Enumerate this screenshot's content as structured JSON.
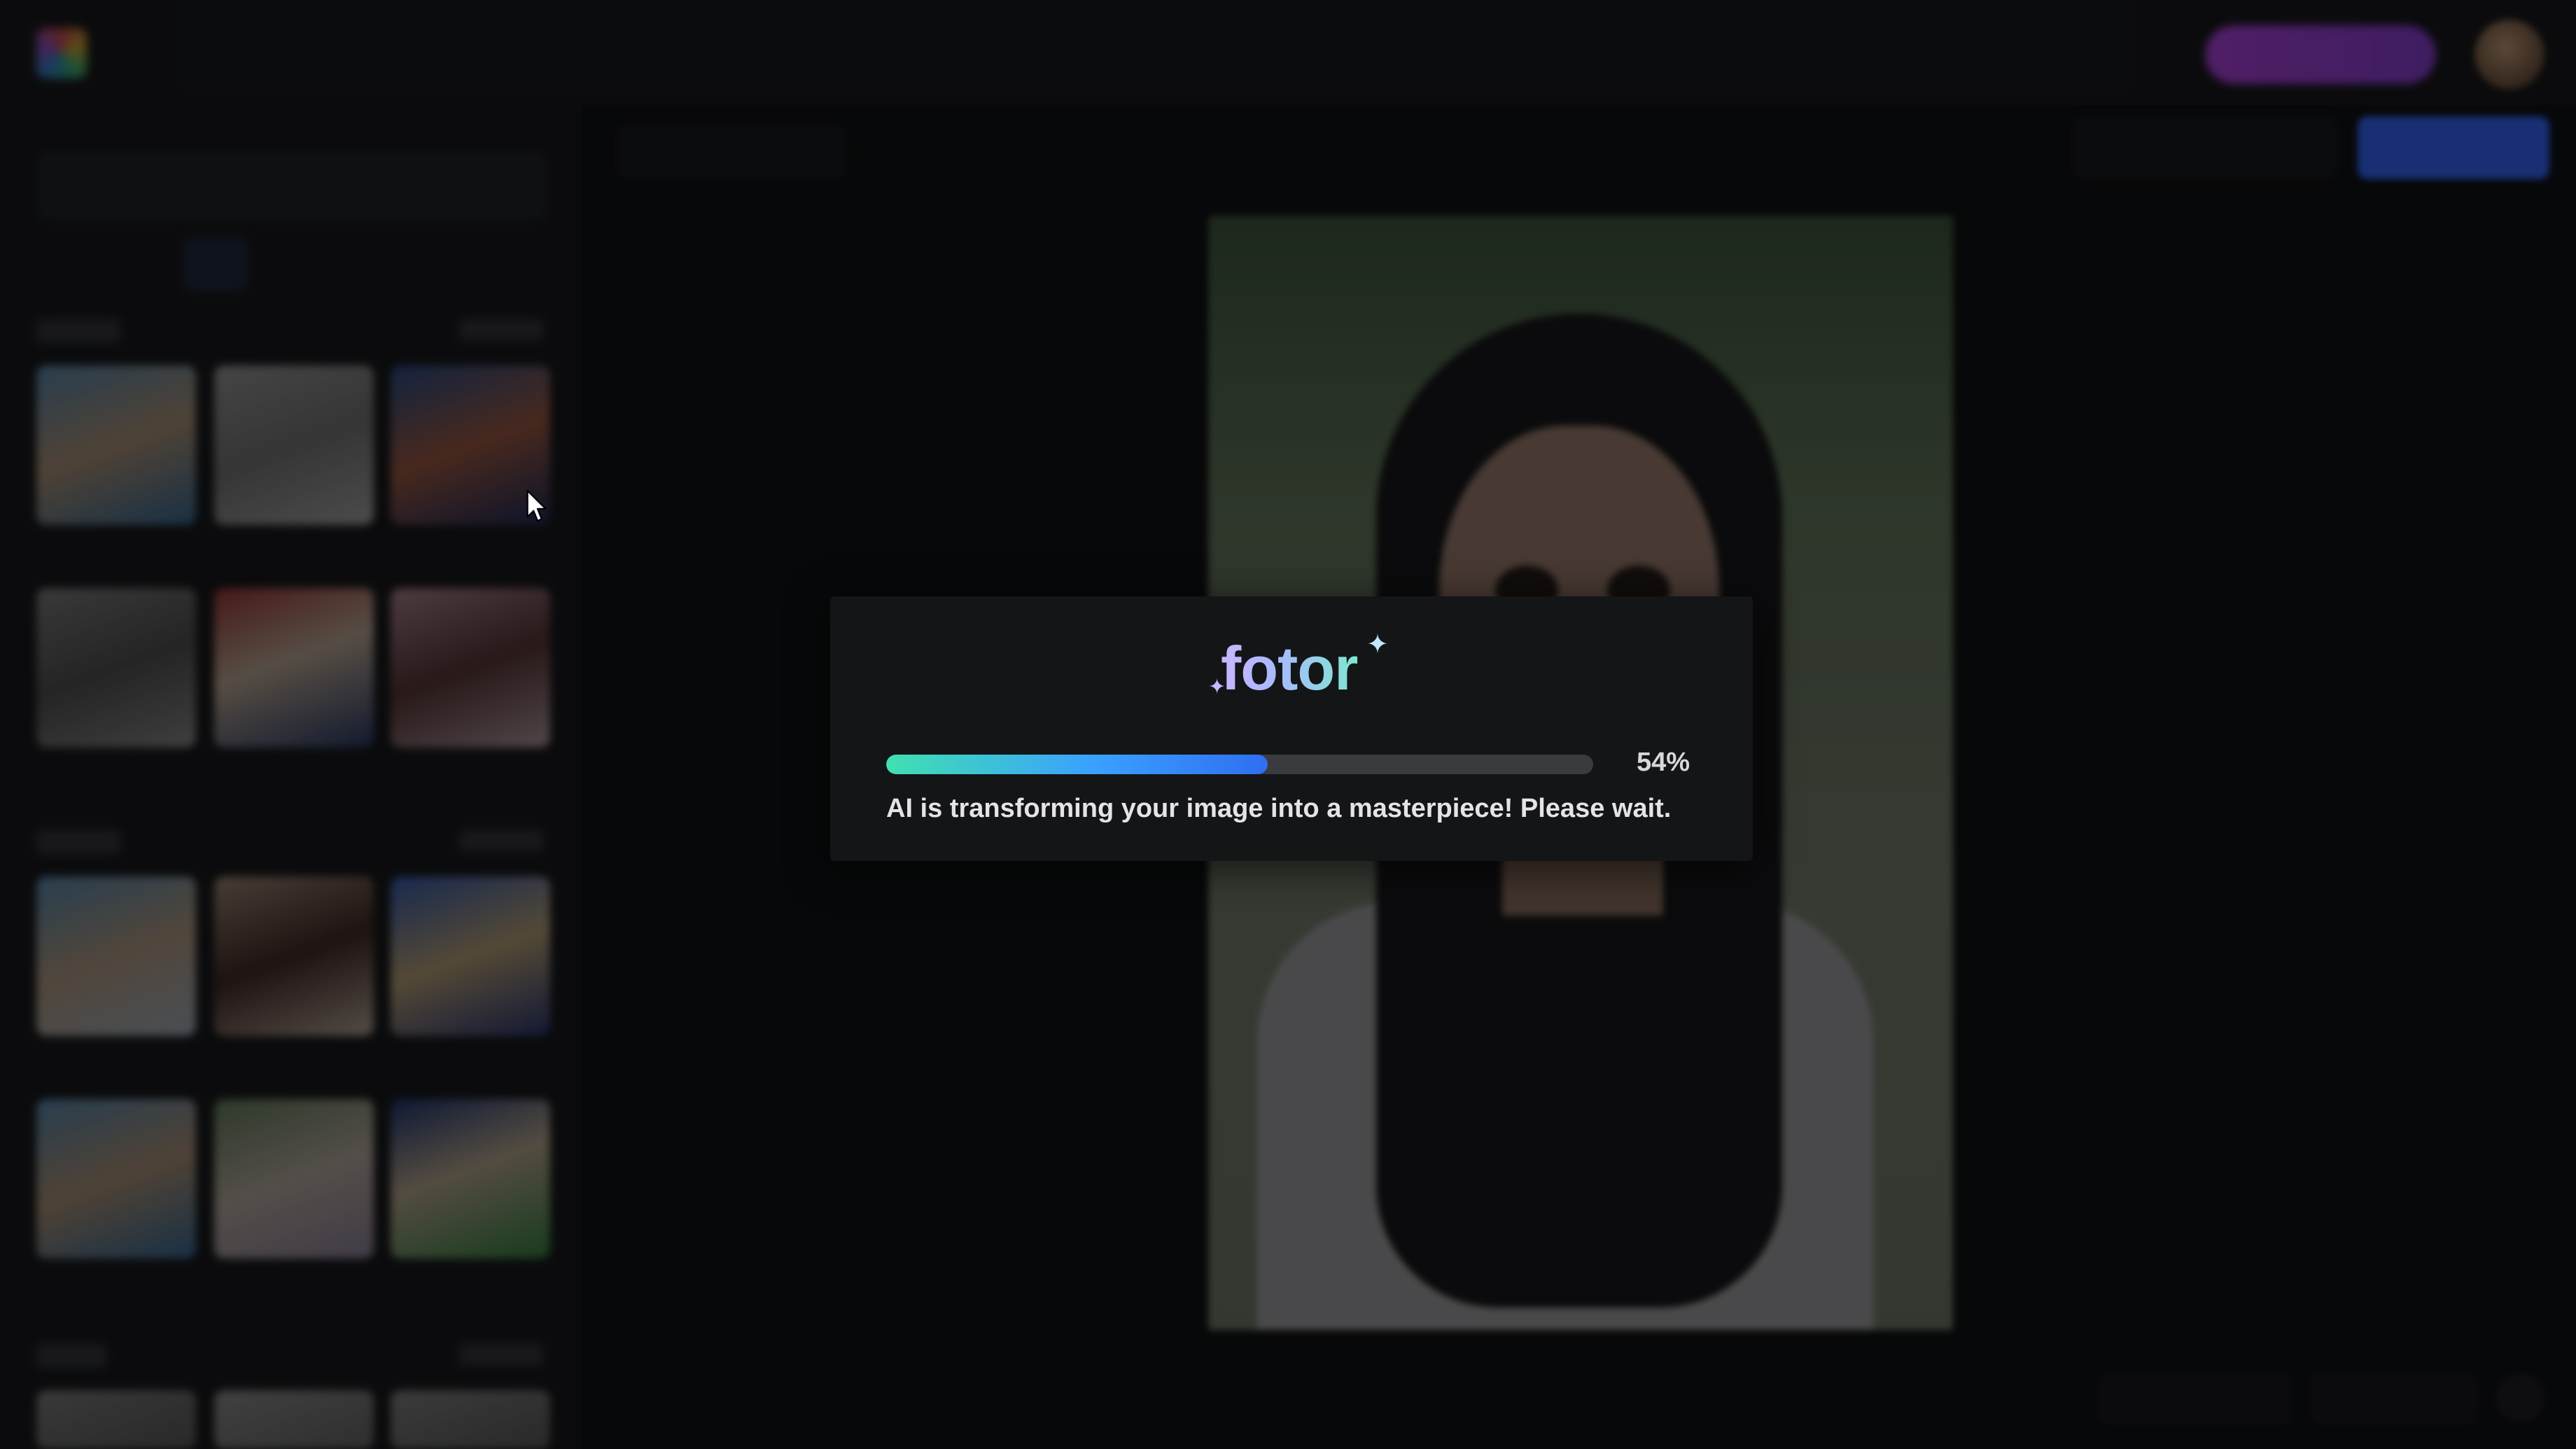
{
  "modal": {
    "logo_text": "fotor",
    "progress_percent": 54,
    "progress_label": "54%",
    "status_message": "AI is transforming your image into a masterpiece! Please wait."
  },
  "colors": {
    "progress_start": "#40e0b0",
    "progress_end": "#2f6ef0",
    "download_button": "#2f5ee6",
    "pro_button": "#b040e0",
    "background": "#0f1012"
  },
  "icons": [
    "fotor-logo-icon",
    "sparkle-icon",
    "mouse-cursor-icon"
  ]
}
